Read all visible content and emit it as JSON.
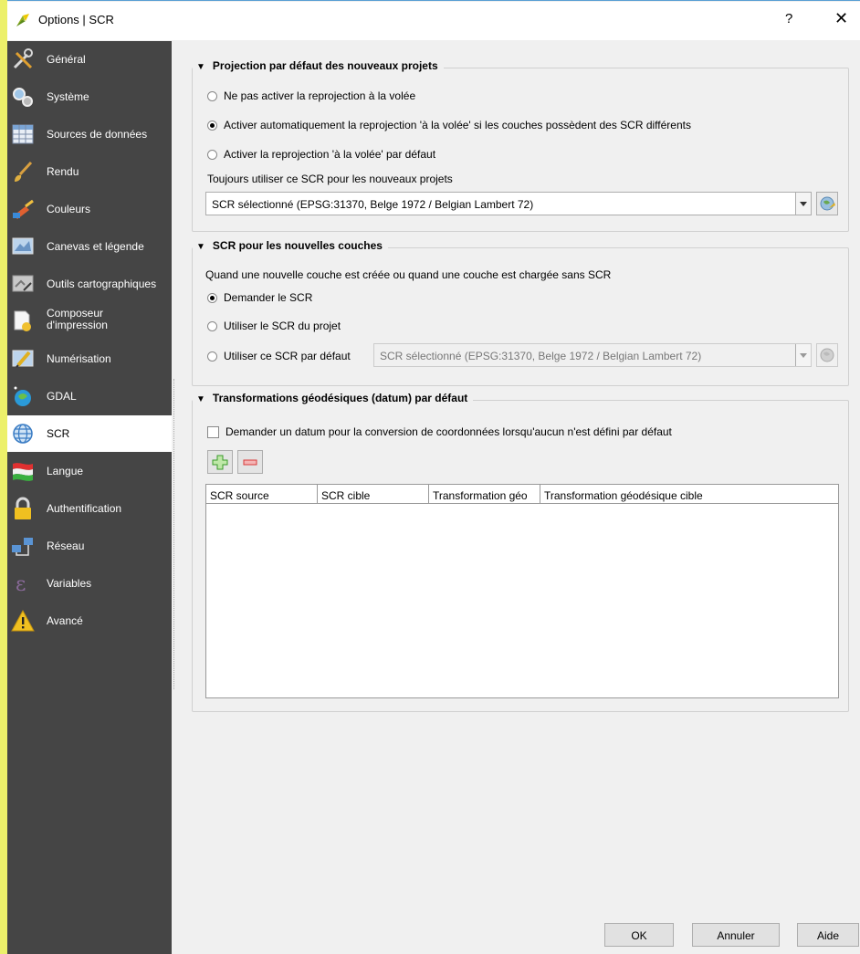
{
  "window": {
    "title": "Options | SCR",
    "help_glyph": "?",
    "close_glyph": "✕"
  },
  "sidebar": {
    "items": [
      {
        "label": "Général",
        "icon": "tools-icon"
      },
      {
        "label": "Système",
        "icon": "gears-icon"
      },
      {
        "label": "Sources de données",
        "icon": "table-icon"
      },
      {
        "label": "Rendu",
        "icon": "paintbrush-icon"
      },
      {
        "label": "Couleurs",
        "icon": "color-brush-icon"
      },
      {
        "label": "Canevas et légende",
        "icon": "map-canvas-icon"
      },
      {
        "label": "Outils cartographiques",
        "icon": "map-tools-icon"
      },
      {
        "label": "Composeur\nd'impression",
        "icon": "composer-icon"
      },
      {
        "label": "Numérisation",
        "icon": "digitize-icon"
      },
      {
        "label": "GDAL",
        "icon": "gdal-icon"
      },
      {
        "label": "SCR",
        "icon": "globe-icon",
        "active": true
      },
      {
        "label": "Langue",
        "icon": "flag-icon"
      },
      {
        "label": "Authentification",
        "icon": "lock-icon"
      },
      {
        "label": "Réseau",
        "icon": "network-icon"
      },
      {
        "label": "Variables",
        "icon": "epsilon-icon"
      },
      {
        "label": "Avancé",
        "icon": "warning-icon"
      }
    ]
  },
  "projection": {
    "title": "Projection par défaut des nouveaux projets",
    "opt1": "Ne pas activer la reprojection à la volée",
    "opt2": "Activer automatiquement la reprojection 'à la volée' si les couches possèdent des SCR différents",
    "opt3": "Activer la reprojection 'à la volée' par défaut",
    "selected": 2,
    "always_label": "Toujours utiliser ce SCR pour les nouveaux projets",
    "crs_value": "SCR sélectionné (EPSG:31370, Belge 1972 / Belgian Lambert 72)"
  },
  "layers": {
    "title": "SCR pour les nouvelles couches",
    "description": "Quand une nouvelle couche est créée ou quand une couche est chargée sans SCR",
    "opt1": "Demander le SCR",
    "opt2": "Utiliser le SCR du projet",
    "opt3": "Utiliser ce SCR par défaut",
    "selected": 1,
    "crs_value": "SCR sélectionné (EPSG:31370, Belge 1972 / Belgian Lambert 72)"
  },
  "datum": {
    "title": "Transformations géodésiques (datum) par défaut",
    "checkbox_label": "Demander un datum pour la conversion de coordonnées lorsqu'aucun n'est défini par défaut",
    "checked": false,
    "columns": [
      "SCR source",
      "SCR cible",
      "Transformation géo",
      "Transformation géodésique cible"
    ],
    "rows": []
  },
  "footer": {
    "ok": "OK",
    "cancel": "Annuler",
    "help": "Aide"
  },
  "colors": {
    "sidebar_bg": "#454545",
    "active_bg": "#ffffff",
    "page_accent": "#ecf06a"
  }
}
